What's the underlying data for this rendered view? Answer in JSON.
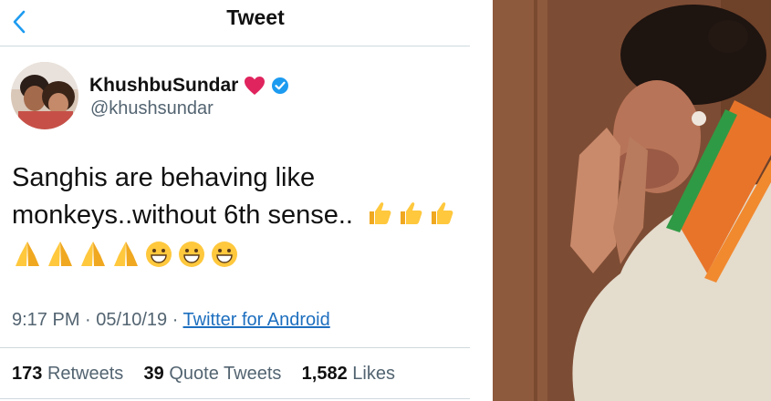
{
  "header": {
    "title": "Tweet",
    "back_icon": "chevron-left-icon"
  },
  "author": {
    "name": "KhushbuSundar",
    "handle": "@khushsundar",
    "badge_icons": [
      "red-heart-icon",
      "verified-badge-icon"
    ]
  },
  "tweet": {
    "line1": "Sanghis are behaving like",
    "line2": "monkeys..without 6th sense..",
    "emojis_line2": [
      "thumbs-up-icon",
      "thumbs-up-icon",
      "thumbs-up-icon"
    ],
    "emojis_line3": [
      "folded-hands-icon",
      "folded-hands-icon",
      "folded-hands-icon",
      "folded-hands-icon",
      "grinning-face-icon",
      "grinning-face-icon",
      "grinning-face-icon"
    ]
  },
  "meta": {
    "time": "9:17 PM",
    "date": "05/10/19",
    "source": "Twitter for Android"
  },
  "stats": {
    "retweets_count": "173",
    "retweets_label": "Retweets",
    "quotes_count": "39",
    "quotes_label": "Quote Tweets",
    "likes_count": "1,582",
    "likes_label": "Likes"
  },
  "colors": {
    "link": "#1d6fbf",
    "verified": "#1d9bf0",
    "heart": "#e0245e"
  }
}
